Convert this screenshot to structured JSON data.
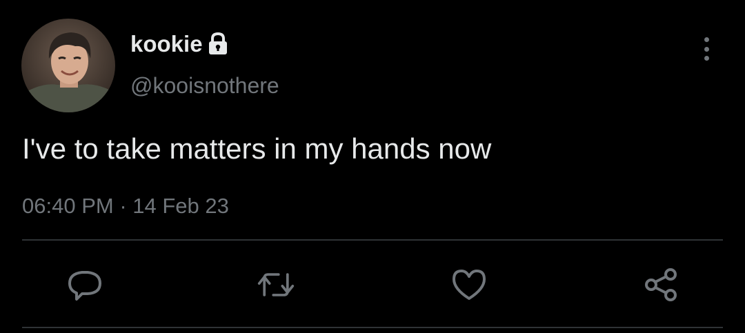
{
  "author": {
    "display_name": "kookie",
    "handle": "@kooisnothere",
    "avatar_icon": "profile-photo",
    "badge_icon": "lock-icon"
  },
  "tweet": {
    "text": "I've to take matters in my hands now",
    "time": "06:40 PM",
    "separator": "·",
    "date": "14 Feb 23"
  },
  "actions": [
    {
      "name": "reply",
      "icon": "speech-bubble-icon"
    },
    {
      "name": "retweet",
      "icon": "retweet-icon"
    },
    {
      "name": "like",
      "icon": "heart-icon"
    },
    {
      "name": "share",
      "icon": "share-icon"
    }
  ],
  "colors": {
    "background": "#000000",
    "primary_text": "#e7e9ea",
    "secondary_text": "#71767b",
    "divider": "#2f3336"
  }
}
